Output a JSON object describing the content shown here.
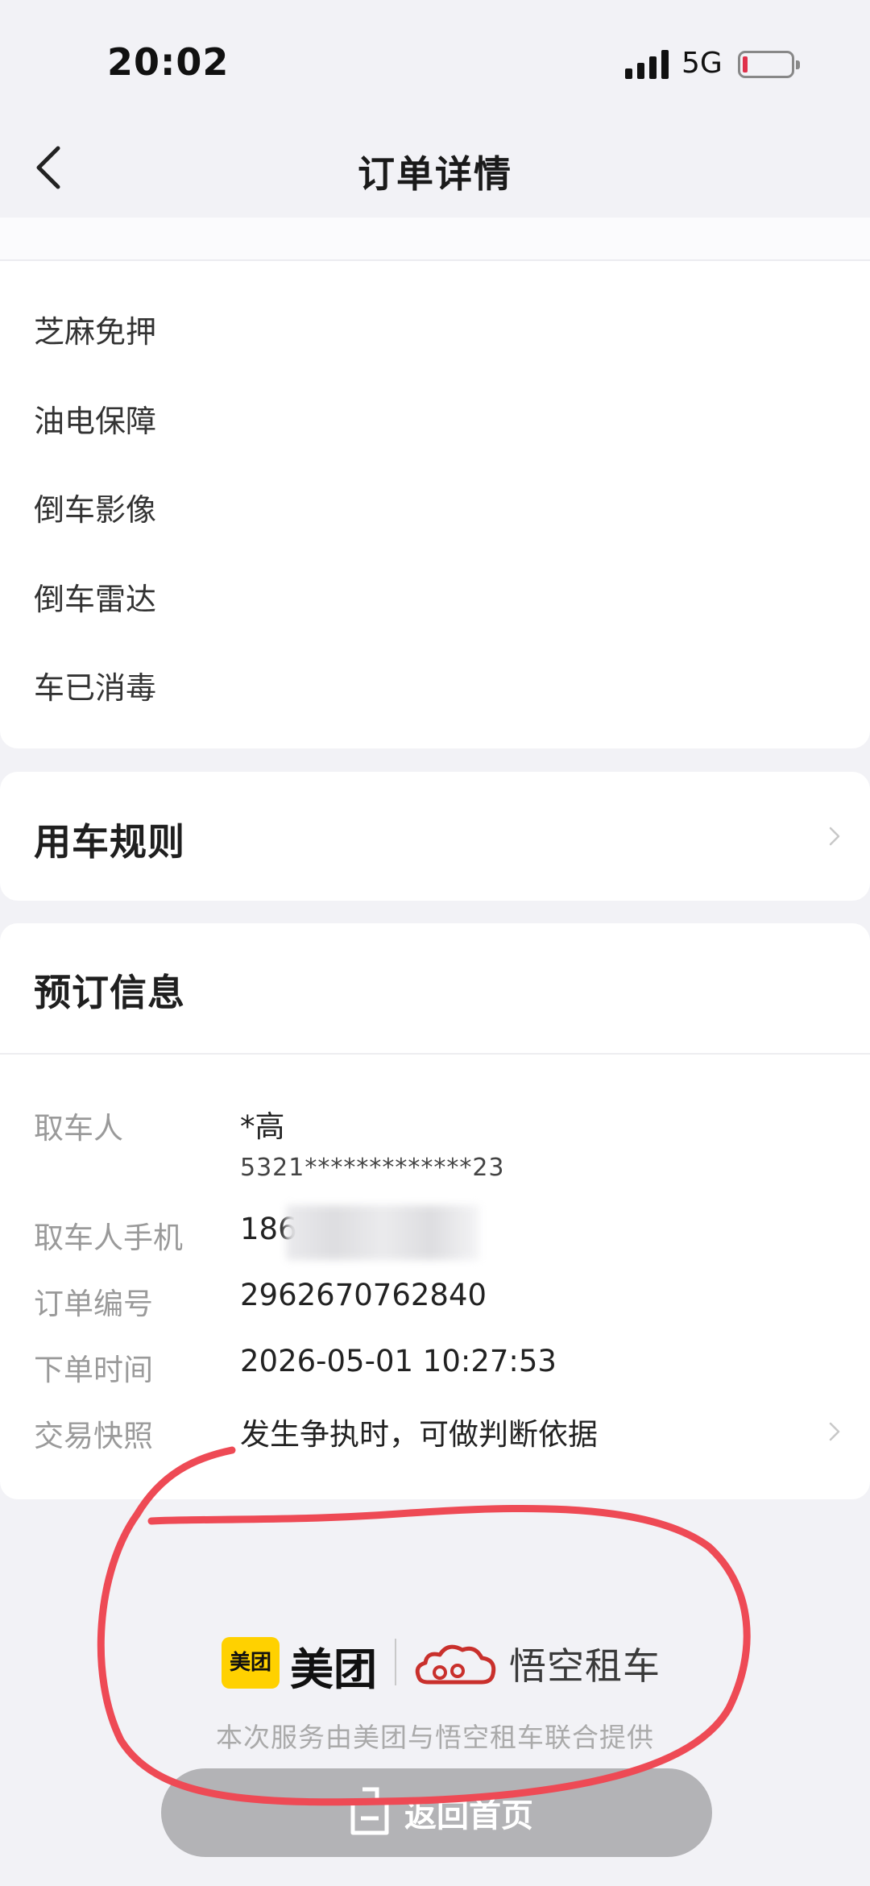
{
  "status_bar": {
    "time": "20:02",
    "network": "5G"
  },
  "header": {
    "title": "订单详情"
  },
  "features": [
    "芝麻免押",
    "油电保障",
    "倒车影像",
    "倒车雷达",
    "车已消毒"
  ],
  "rules": {
    "title": "用车规则"
  },
  "booking": {
    "title": "预订信息",
    "rows": [
      {
        "label": "取车人",
        "value": "*高",
        "sub": "5321*************23"
      },
      {
        "label": "取车人手机",
        "value": "186"
      },
      {
        "label": "订单编号",
        "value": "2962670762840"
      },
      {
        "label": "下单时间",
        "value": "2026-05-01 10:27:53"
      },
      {
        "label": "交易快照",
        "value": "发生争执时，可做判断依据"
      }
    ]
  },
  "footer": {
    "meituan_badge": "美团",
    "meituan_name": "美团",
    "wukong_name": "悟空租车",
    "note": "本次服务由美团与悟空租车联合提供",
    "home_button": "返回首页"
  },
  "colors": {
    "annotation": "#ee4a55",
    "meituan_yellow": "#ffd100",
    "wukong_red": "#c9302c"
  }
}
